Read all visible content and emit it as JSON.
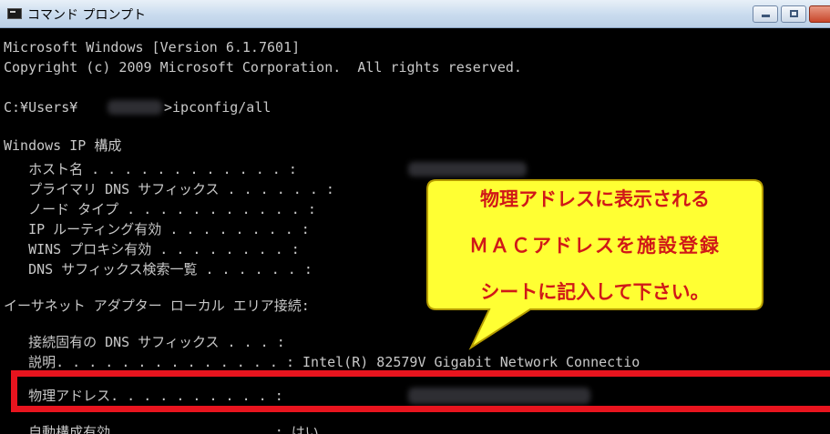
{
  "window": {
    "title": "コマンド プロンプト",
    "controls": [
      "minimize",
      "maximize",
      "close"
    ]
  },
  "console": {
    "lines": [
      "Microsoft Windows [Version 6.1.7601]",
      "Copyright (c) 2009 Microsoft Corporation.  All rights reserved.",
      "C:¥Users¥",
      ">ipconfig/all",
      "Windows IP 構成",
      "   ホスト名 . . . . . . . . . . . . :",
      "   プライマリ DNS サフィックス . . . . . . :",
      "   ノード タイプ . . . . . . . . . . . :",
      "   IP ルーティング有効 . . . . . . . . :",
      "   WINS プロキシ有効 . . . . . . . . :",
      "   DNS サフィックス検索一覧 . . . . . . :",
      "イーサネット アダプター ローカル エリア接続:",
      "   接続固有の DNS サフィックス . . . :",
      "   説明. . . . . . . . . . . . . . : Intel(R) 82579V Gigabit Network Connectio",
      "   物理アドレス. . . . . . . . . . :",
      "   自動構成有効. . . . . . . . . . : はい"
    ]
  },
  "callout": {
    "lines": [
      "物理アドレスに表示される",
      "ＭＡＣアドレスを施設登録",
      "シートに記入して下さい。"
    ],
    "fill": "#ffff33",
    "text_color": "#d01818"
  },
  "highlight": {
    "color": "#e8141e"
  },
  "colors": {
    "console_bg": "#000000",
    "console_text": "#c8c8c8"
  }
}
